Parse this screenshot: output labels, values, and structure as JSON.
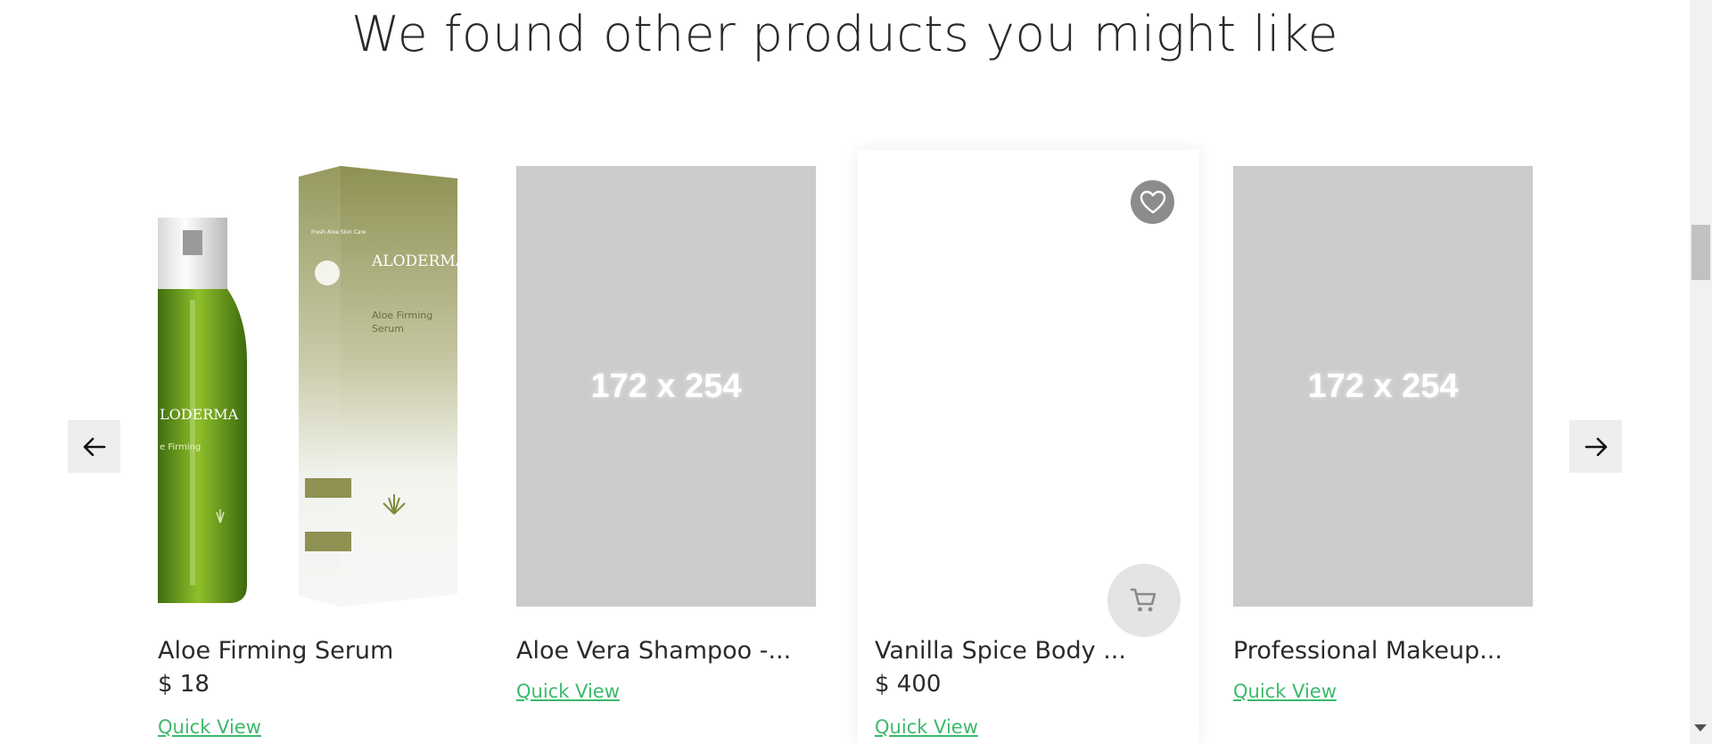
{
  "heading": "We found other products you might like",
  "carousel": {
    "prev_icon": "arrow-left-icon",
    "next_icon": "arrow-right-icon"
  },
  "products": [
    {
      "name": "Aloe Firming Serum",
      "price": "$ 18",
      "quick_view": "Quick View",
      "image": "aloe-serum-photo"
    },
    {
      "name": "Aloe Vera Shampoo -...",
      "price": "",
      "quick_view": "Quick View",
      "image_placeholder": "172 x 254"
    },
    {
      "name": "Vanilla Spice Body ...",
      "price": "$ 400",
      "quick_view": "Quick View",
      "image": "blank"
    },
    {
      "name": "Professional Makeup...",
      "price": "",
      "quick_view": "Quick View",
      "image_placeholder": "172 x 254"
    }
  ],
  "product_image_text": {
    "brand": "ALODERMA",
    "product_line": "Aloe Firming",
    "product_line_2": "Serum",
    "box_header": "Fresh Aloe Skin Care"
  },
  "colors": {
    "link": "#3cb96b",
    "placeholder": "#cccccc",
    "arrow_bg": "#eceeef"
  }
}
